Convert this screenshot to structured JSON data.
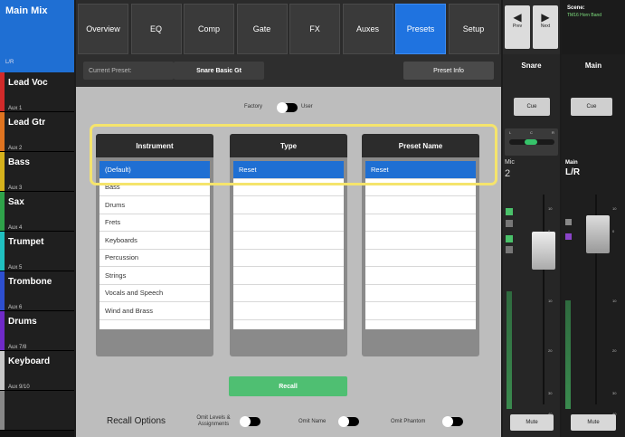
{
  "main_mix": {
    "title": "Main Mix",
    "sub": "L/R"
  },
  "mixes": [
    {
      "sub": "",
      "name": "Lead Voc",
      "color": "#d12a2a"
    },
    {
      "sub": "Aux 1",
      "name": "Lead Gtr",
      "color": "#e07420"
    },
    {
      "sub": "Aux 2",
      "name": "Bass",
      "color": "#d6b21c"
    },
    {
      "sub": "Aux 3",
      "name": "Sax",
      "color": "#2fa34a"
    },
    {
      "sub": "Aux 4",
      "name": "Trumpet",
      "color": "#20c0c0"
    },
    {
      "sub": "Aux 5",
      "name": "Trombone",
      "color": "#2d4fd0"
    },
    {
      "sub": "Aux 6",
      "name": "Drums",
      "color": "#6f2ac8"
    },
    {
      "sub": "Aux 7/8",
      "name": "Keyboard",
      "color": "#c8c8c8"
    },
    {
      "sub": "Aux 9/10",
      "name": "",
      "color": "#888888"
    }
  ],
  "tabs": [
    "Overview",
    "EQ",
    "Comp",
    "Gate",
    "FX",
    "Auxes",
    "Presets",
    "Setup"
  ],
  "selected_tab": "Presets",
  "nav": {
    "prev": "Prev",
    "next": "Next"
  },
  "scene": {
    "label": "Scene:",
    "name": "TM16 Horn Band"
  },
  "preset_bar": {
    "current_label": "Current Preset:",
    "current_value": "Snare Basic Gt",
    "info_button": "Preset Info"
  },
  "source_toggle": {
    "left": "Factory",
    "right": "User"
  },
  "columns": [
    {
      "header": "Instrument",
      "items": [
        "(Default)",
        "Bass",
        "Drums",
        "Frets",
        "Keyboards",
        "Percussion",
        "Strings",
        "Vocals and Speech",
        "Wind and Brass"
      ],
      "selected": 0
    },
    {
      "header": "Type",
      "items": [
        "Reset"
      ],
      "selected": 0
    },
    {
      "header": "Preset Name",
      "items": [
        "Reset"
      ],
      "selected": 0
    }
  ],
  "recall_button": "Recall",
  "recall_options": {
    "label": "Recall Options",
    "omit_levels": "Omit Levels & Assignments",
    "omit_name": "Omit Name",
    "omit_phantom": "Omit Phantom"
  },
  "channel_strip": {
    "name": "Snare",
    "cue": "Cue",
    "pan_l": "L",
    "pan_c": "C",
    "pan_r": "R",
    "input": "Mic",
    "number": "2",
    "mute": "Mute",
    "scale": [
      "10",
      "0",
      "10",
      "20",
      "30",
      "40"
    ]
  },
  "main_strip": {
    "name": "Main",
    "cue": "Cue",
    "label": "Main",
    "sub": "L/R",
    "mute": "Mute",
    "scale": [
      "10",
      "0",
      "10",
      "20",
      "30",
      "40"
    ]
  }
}
